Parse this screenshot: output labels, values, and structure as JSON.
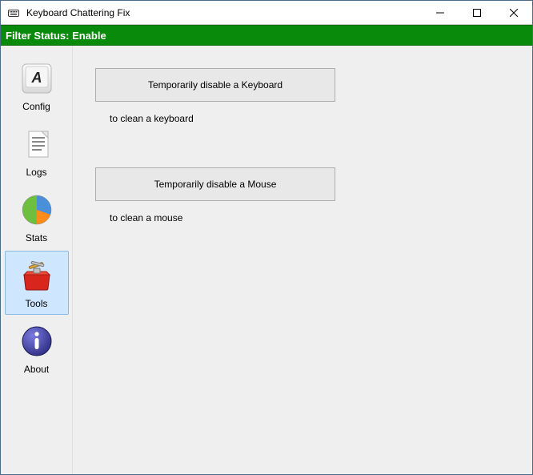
{
  "window": {
    "title": "Keyboard Chattering Fix"
  },
  "status": {
    "text": "Filter Status: Enable"
  },
  "sidebar": {
    "items": [
      {
        "label": "Config"
      },
      {
        "label": "Logs"
      },
      {
        "label": "Stats"
      },
      {
        "label": "Tools"
      },
      {
        "label": "About"
      }
    ],
    "selectedIndex": 3
  },
  "main": {
    "keyboard": {
      "button": "Temporarily disable a Keyboard",
      "desc": "to clean a keyboard"
    },
    "mouse": {
      "button": "Temporarily disable a Mouse",
      "desc": "to clean a mouse"
    }
  }
}
